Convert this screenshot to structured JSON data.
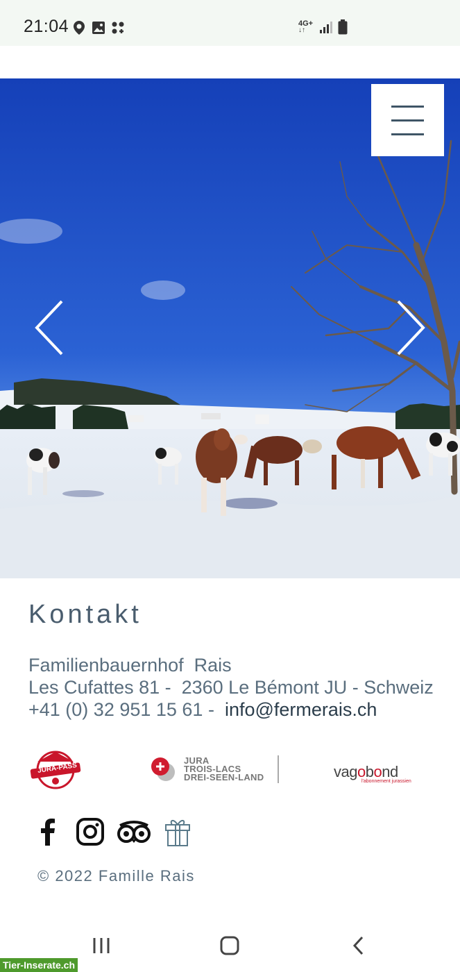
{
  "status_bar": {
    "time": "21:04",
    "network": "4G+",
    "icons": [
      "location-icon",
      "gallery-icon",
      "apps-icon",
      "signal-icon",
      "battery-icon"
    ]
  },
  "header": {
    "menu_icon": "hamburger-icon"
  },
  "hero": {
    "prev_icon": "chevron-left-icon",
    "next_icon": "chevron-right-icon"
  },
  "contact": {
    "title": "Kontakt",
    "name": "Familienbauernhof  Rais",
    "address": "Les Cufattes 81 -  2360 Le Bémont JU - Schweiz",
    "phone": "+41 (0) 32 951 15 61 -  ",
    "email": "info@fermerais.ch"
  },
  "logos": {
    "jura_pass": "JURA-PASS",
    "trois_lacs": [
      "JURA",
      "TROIS-LACS",
      "DREI-SEEN-LAND"
    ],
    "vagabond_a": "vag",
    "vagabond_o1": "o",
    "vagabond_b": "b",
    "vagabond_o2": "o",
    "vagabond_c": "nd",
    "vagabond_sub": "l'abonnement jurassien"
  },
  "social": [
    "facebook-icon",
    "instagram-icon",
    "tripadvisor-icon",
    "gift-icon"
  ],
  "footer": {
    "copyright": "© 2022 Famille Rais"
  },
  "watermark": "Tier-Inserate.ch",
  "colors": {
    "text": "#4a5d6e",
    "sky": "#1d4fc4",
    "accent_red": "#c9162b",
    "watermark_green": "#4e9a2c"
  }
}
